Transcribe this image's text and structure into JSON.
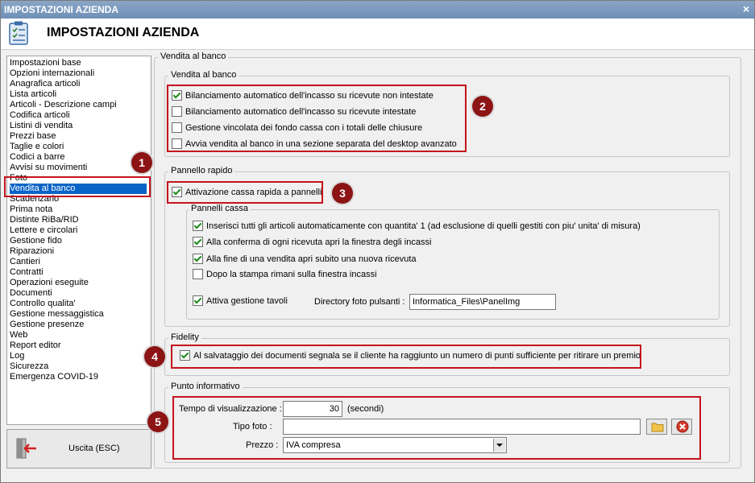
{
  "window": {
    "title": "IMPOSTAZIONI AZIENDA",
    "close_glyph": "×"
  },
  "header": {
    "title": "IMPOSTAZIONI AZIENDA",
    "icon": "clipboard-checklist-icon"
  },
  "sidebar": {
    "items": [
      "Impostazioni base",
      "Opzioni internazionali",
      "Anagrafica articoli",
      "Lista articoli",
      "Articoli - Descrizione campi",
      "Codifica articoli",
      "Listini di vendita",
      "Prezzi base",
      "Taglie e colori",
      "Codici a barre",
      "Avvisi su movimenti",
      "Foto",
      "Vendita al banco",
      "Scadenzario",
      "Prima nota",
      "Distinte RiBa/RID",
      "Lettere e circolari",
      "Gestione fido",
      "Riparazioni",
      "Cantieri",
      "Contratti",
      "Operazioni eseguite",
      "Documenti",
      "Controllo qualita'",
      "Gestione messaggistica",
      "Gestione presenze",
      "Web",
      "Report editor",
      "Log",
      "Sicurezza",
      "Emergenza COVID-19"
    ],
    "selected": "Vendita al banco"
  },
  "exit_button": {
    "label": "Uscita (ESC)",
    "icon": "exit-door-icon"
  },
  "main": {
    "group_title": "Vendita al banco",
    "vendita": {
      "title": "Vendita al banco",
      "options": [
        {
          "label": "Bilanciamento automatico dell'incasso su ricevute non intestate",
          "checked": true
        },
        {
          "label": "Bilanciamento automatico dell'incasso su ricevute intestate",
          "checked": false
        },
        {
          "label": "Gestione vincolata dei fondo cassa con i totali delle chiusure",
          "checked": false
        },
        {
          "label": "Avvia vendita al banco in una sezione separata del desktop avanzato",
          "checked": false
        }
      ]
    },
    "pannello": {
      "title": "Pannello rapido",
      "activation": {
        "label": "Attivazione cassa rapida a pannelli",
        "checked": true
      },
      "pannelli_cassa": {
        "title": "Pannelli cassa",
        "options": [
          {
            "label": "Inserisci tutti gli articoli automaticamente con quantita' 1 (ad esclusione di quelli gestiti con piu' unita' di misura)",
            "checked": true
          },
          {
            "label": "Alla conferma di ogni ricevuta apri la finestra degli incassi",
            "checked": true
          },
          {
            "label": "Alla fine di una vendita apri subito una nuova ricevuta",
            "checked": true
          },
          {
            "label": "Dopo la stampa rimani sulla finestra incassi",
            "checked": false
          }
        ],
        "tavoli": {
          "label": "Attiva gestione tavoli",
          "checked": true
        },
        "directory_label": "Directory foto pulsanti :",
        "directory_value": "Informatica_Files\\PanelImg"
      }
    },
    "fidelity": {
      "title": "Fidelity",
      "option": {
        "label": "Al salvataggio dei documenti segnala se il cliente ha raggiunto un numero di punti sufficiente per ritirare un premio",
        "checked": true
      }
    },
    "punto": {
      "title": "Punto informativo",
      "tempo_label": "Tempo di visualizzazione :",
      "tempo_value": "30",
      "tempo_unit": "(secondi)",
      "tipo_foto_label": "Tipo foto :",
      "tipo_foto_value": "",
      "prezzo_label": "Prezzo :",
      "prezzo_value": "IVA compresa"
    }
  },
  "badges": [
    "1",
    "2",
    "3",
    "4",
    "5"
  ],
  "colors": {
    "highlight": "#c4141b",
    "badge": "#8c1414",
    "selection": "#0a64c8",
    "check": "#1d8a1d"
  }
}
